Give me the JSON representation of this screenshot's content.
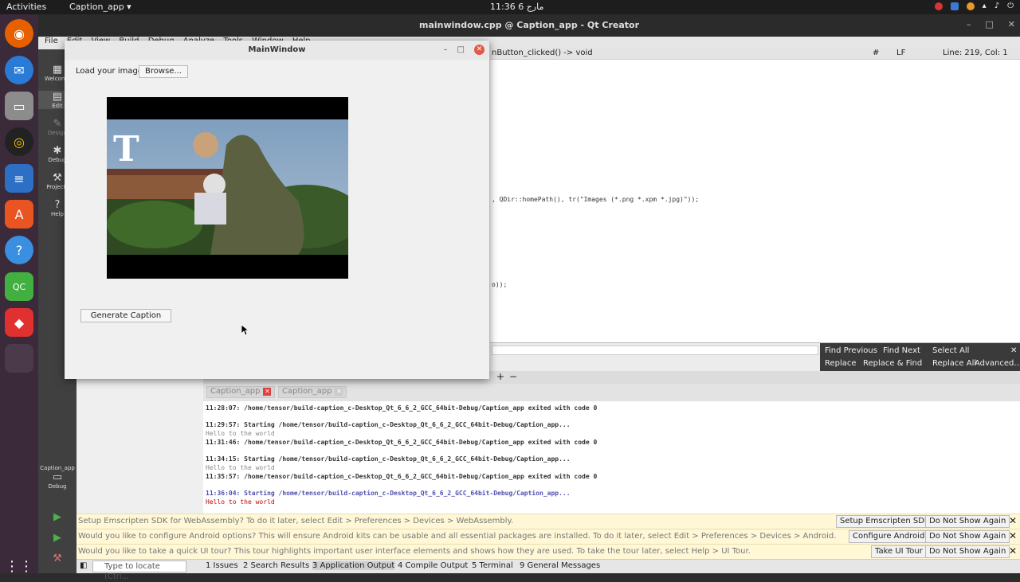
{
  "topbar": {
    "activities": "Activities",
    "app_menu": "Caption_app ▾",
    "clock": "11:36 مارج 6"
  },
  "qtc": {
    "title": "mainwindow.cpp @ Caption_app - Qt Creator",
    "menu": [
      "File",
      "Edit",
      "View",
      "Build",
      "Debug",
      "Analyze",
      "Tools",
      "Window",
      "Help"
    ],
    "modes": [
      {
        "label": "Welcome",
        "icon": "grid-icon"
      },
      {
        "label": "Edit",
        "icon": "edit-icon"
      },
      {
        "label": "Design",
        "icon": "design-icon"
      },
      {
        "label": "Debug",
        "icon": "bug-icon"
      },
      {
        "label": "Projects",
        "icon": "wrench-icon"
      },
      {
        "label": "Help",
        "icon": "help-icon"
      }
    ],
    "kit": {
      "project": "Caption_app",
      "config": "Debug"
    },
    "editor_header": {
      "function": "nButton_clicked() -> void",
      "hash": "#",
      "line_ending": "LF",
      "position": "Line: 219, Col: 1"
    },
    "code": {
      "line1": ", QDir::homePath(), tr(\"Images (*.png *.xpm *.jpg)\"));",
      "line2": "o));"
    },
    "find": {
      "find_previous": "Find Previous",
      "find_next": "Find Next",
      "select_all": "Select All",
      "replace": "Replace",
      "replace_find": "Replace & Find",
      "replace_all": "Replace All",
      "advanced": "Advanced..."
    },
    "output_tabs": [
      "Caption_app",
      "Caption_app"
    ],
    "log": [
      {
        "text": "11:28:07: /home/tensor/build-caption_c-Desktop_Qt_6_6_2_GCC_64bit-Debug/Caption_app exited with code 0",
        "style": "bold"
      },
      {
        "text": "11:29:57: Starting /home/tensor/build-caption_c-Desktop_Qt_6_6_2_GCC_64bit-Debug/Caption_app...",
        "style": "bold"
      },
      {
        "text": "Hello to the world",
        "style": "plain"
      },
      {
        "text": "11:31:46: /home/tensor/build-caption_c-Desktop_Qt_6_6_2_GCC_64bit-Debug/Caption_app exited with code 0",
        "style": "bold"
      },
      {
        "text": "11:34:15: Starting /home/tensor/build-caption_c-Desktop_Qt_6_6_2_GCC_64bit-Debug/Caption_app...",
        "style": "bold"
      },
      {
        "text": "Hello to the world",
        "style": "plain"
      },
      {
        "text": "11:35:57: /home/tensor/build-caption_c-Desktop_Qt_6_6_2_GCC_64bit-Debug/Caption_app exited with code 0",
        "style": "bold"
      },
      {
        "text": "11:36:04: Starting /home/tensor/build-caption_c-Desktop_Qt_6_6_2_GCC_64bit-Debug/Caption_app...",
        "style": "blue"
      },
      {
        "text": "Hello to the world",
        "style": "red"
      }
    ],
    "infobars": [
      {
        "msg": "Setup Emscripten SDK for WebAssembly? To do it later, select Edit > Preferences > Devices > WebAssembly.",
        "action": "Setup Emscripten SDK",
        "dismiss": "Do Not Show Again"
      },
      {
        "msg": "Would you like to configure Android options? This will ensure Android kits can be usable and all essential packages are installed. To do it later, select Edit > Preferences > Devices > Android.",
        "action": "Configure Android",
        "dismiss": "Do Not Show Again"
      },
      {
        "msg": "Would you like to take a quick UI tour? This tour highlights important user interface elements and shows how they are used. To take the tour later, select Help > UI Tour.",
        "action": "Take UI Tour",
        "dismiss": "Do Not Show Again"
      }
    ],
    "statusbar": {
      "locate_placeholder": "Type to locate (Ctrl...",
      "tabs": [
        "1 Issues",
        "2 Search Results",
        "3 Application Output",
        "4 Compile Output",
        "5 Terminal",
        "9 General Messages"
      ]
    }
  },
  "mainwindow": {
    "title": "MainWindow",
    "load_label": "Load your image",
    "browse": "Browse...",
    "generate": "Generate Caption"
  }
}
